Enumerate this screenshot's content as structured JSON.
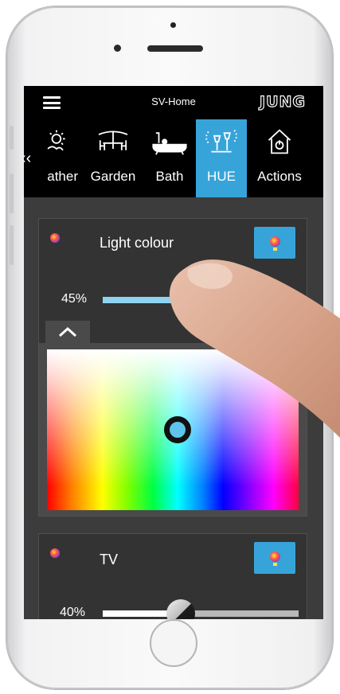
{
  "header": {
    "app_title": "SV-Home",
    "brand": "JUNG"
  },
  "tabs": [
    {
      "label": "ather",
      "icon": "weather-icon",
      "active": false
    },
    {
      "label": "Garden",
      "icon": "garden-icon",
      "active": false
    },
    {
      "label": "Bath",
      "icon": "bath-icon",
      "active": false
    },
    {
      "label": "HUE",
      "icon": "hue-lights-icon",
      "active": true
    },
    {
      "label": "Actions",
      "icon": "home-power-icon",
      "active": false
    }
  ],
  "tab_scroll_glyph": "‹‹",
  "cards": [
    {
      "title": "Light colour",
      "brightness_label": "45%",
      "brightness": 0.45,
      "fill_color": "#8fd3f0",
      "picker_expanded": true
    },
    {
      "title": "TV",
      "brightness_label": "40%",
      "brightness": 0.4,
      "fill_color": "#ffffff"
    }
  ],
  "picker": {
    "selected_color": "#5ec4ec"
  },
  "colors": {
    "accent": "#37a4d9",
    "background": "#3c3c3c",
    "card": "#333333",
    "bar": "#000000"
  }
}
